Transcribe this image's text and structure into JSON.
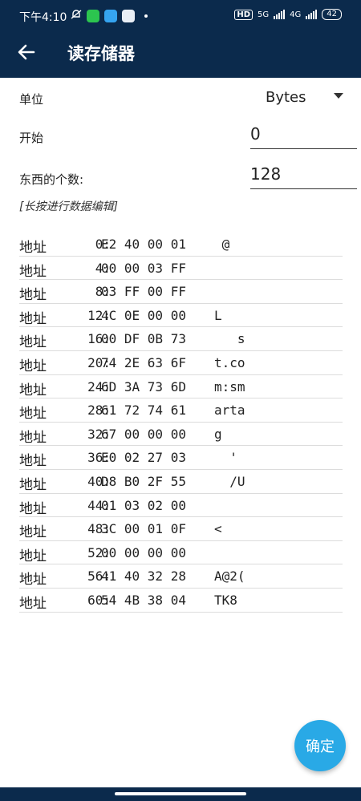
{
  "status_bar": {
    "time": "下午4:10",
    "battery": "42",
    "net1": "5G",
    "net2": "4G",
    "hd": "HD"
  },
  "app_bar": {
    "title": "读存储器"
  },
  "form": {
    "unit_label": "单位",
    "unit_value": "Bytes",
    "start_label": "开始",
    "start_value": "0",
    "count_label": "东西的个数:",
    "count_value": "128",
    "hint": "[长按进行数据编辑]"
  },
  "memory": {
    "addr_label": "地址",
    "rows": [
      {
        "addr": "0:",
        "hex": "E2 40 00 01",
        "ascii": " @"
      },
      {
        "addr": "4:",
        "hex": "00 00 03 FF",
        "ascii": ""
      },
      {
        "addr": "8:",
        "hex": "03 FF 00 FF",
        "ascii": ""
      },
      {
        "addr": "12:",
        "hex": "4C 0E 00 00",
        "ascii": "L"
      },
      {
        "addr": "16:",
        "hex": "00 DF 0B 73",
        "ascii": "   s"
      },
      {
        "addr": "20:",
        "hex": "74 2E 63 6F",
        "ascii": "t.co"
      },
      {
        "addr": "24:",
        "hex": "6D 3A 73 6D",
        "ascii": "m:sm"
      },
      {
        "addr": "28:",
        "hex": "61 72 74 61",
        "ascii": "arta"
      },
      {
        "addr": "32:",
        "hex": "67 00 00 00",
        "ascii": "g"
      },
      {
        "addr": "36:",
        "hex": "E0 02 27 03",
        "ascii": "  '"
      },
      {
        "addr": "40:",
        "hex": "D8 B0 2F 55",
        "ascii": "  /U"
      },
      {
        "addr": "44:",
        "hex": "01 03 02 00",
        "ascii": ""
      },
      {
        "addr": "48:",
        "hex": "3C 00 01 0F",
        "ascii": "<"
      },
      {
        "addr": "52:",
        "hex": "00 00 00 00",
        "ascii": ""
      },
      {
        "addr": "56:",
        "hex": "41 40 32 28",
        "ascii": "A@2("
      },
      {
        "addr": "60:",
        "hex": "54 4B 38 04",
        "ascii": "TK8"
      }
    ]
  },
  "fab": {
    "label": "确定"
  },
  "colors": {
    "app_bar": "#0b2a4c",
    "fab": "#29a9e6"
  }
}
